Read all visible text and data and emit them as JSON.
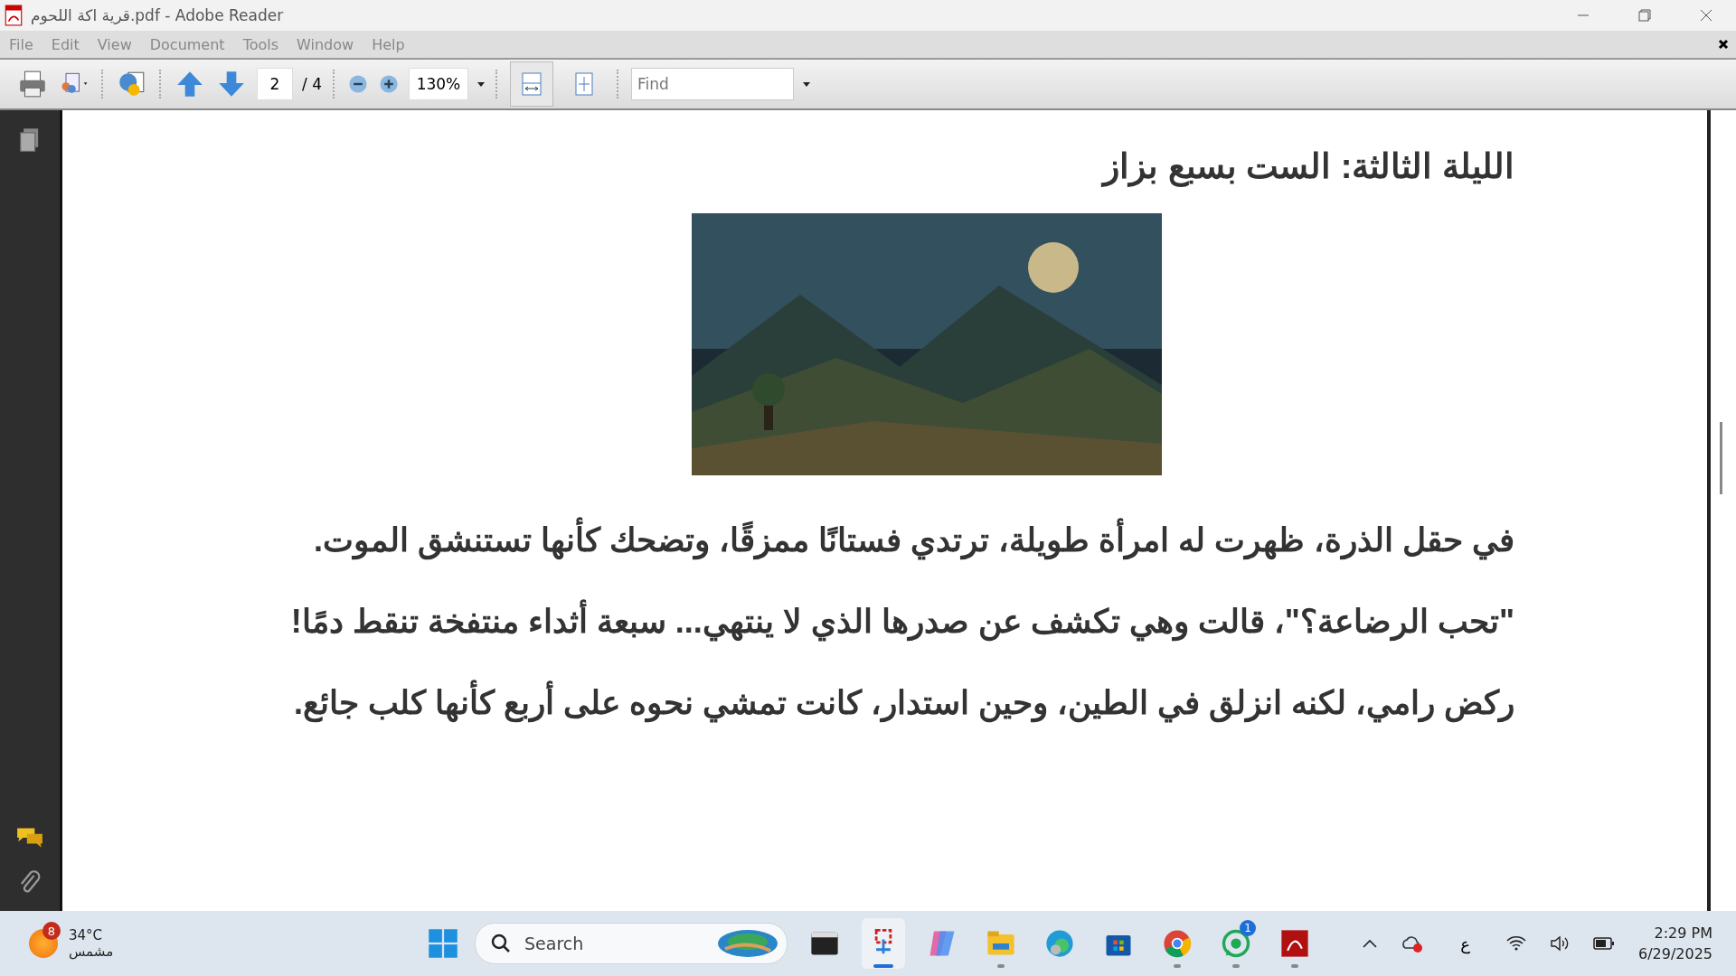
{
  "window": {
    "title": "قرية اكة  اللحوم.pdf - Adobe Reader"
  },
  "menu": [
    "File",
    "Edit",
    "View",
    "Document",
    "Tools",
    "Window",
    "Help"
  ],
  "toolbar": {
    "page_number": "2",
    "page_total": "/ 4",
    "zoom": "130%",
    "find_placeholder": "Find",
    "view_buttons": [
      {
        "kind": "fit-width",
        "selected": true
      },
      {
        "kind": "fit-page",
        "selected": false
      }
    ]
  },
  "document": {
    "heading": "الليلة الثالثة: الست بسبع بزاز",
    "paragraphs": [
      "في حقل الذرة، ظهرت له امرأة طويلة، ترتدي فستانًا ممزقًا، وتضحك كأنها تستنشق الموت.",
      "\"تحب الرضاعة؟\"، قالت وهي تكشف عن صدرها الذي لا ينتهي... سبعة أثداء منتفخة تنقط دمًا!",
      "ركض رامي، لكنه انزلق في الطين، وحين استدار، كانت تمشي نحوه على أربع كأنها كلب جائع."
    ]
  },
  "taskbar": {
    "weather": {
      "badge": "8",
      "temperature": "34°C",
      "condition": "مشمس"
    },
    "search_placeholder": "Search",
    "apps": [
      {
        "kind": "terminal",
        "selected": false,
        "running": false
      },
      {
        "kind": "snip",
        "selected": true,
        "running": true
      },
      {
        "kind": "copilot",
        "selected": false,
        "running": false
      },
      {
        "kind": "explorer",
        "selected": false,
        "running": true
      },
      {
        "kind": "edge",
        "selected": false,
        "running": false
      },
      {
        "kind": "store",
        "selected": false,
        "running": false
      },
      {
        "kind": "chrome",
        "selected": false,
        "running": true
      },
      {
        "kind": "whatsapp",
        "selected": false,
        "running": true,
        "badge": "1"
      },
      {
        "kind": "acrobat",
        "selected": false,
        "running": true
      }
    ],
    "language": "ع",
    "time": "2:29 PM",
    "date": "6/29/2025"
  }
}
